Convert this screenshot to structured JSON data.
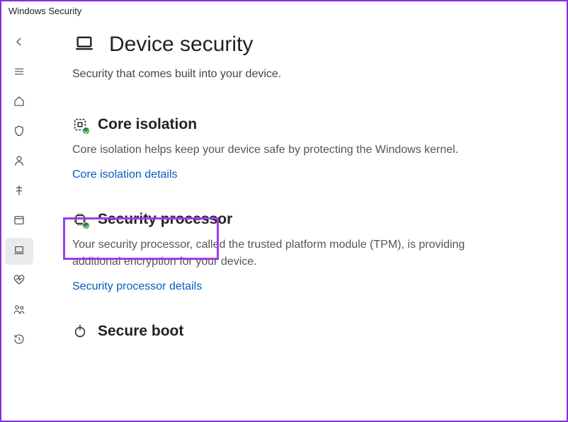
{
  "window": {
    "title": "Windows Security"
  },
  "sidebar": {
    "items": [
      {
        "name": "back",
        "icon": "arrow-left"
      },
      {
        "name": "menu",
        "icon": "menu"
      },
      {
        "name": "home",
        "icon": "home"
      },
      {
        "name": "virus-protection",
        "icon": "shield"
      },
      {
        "name": "account-protection",
        "icon": "person"
      },
      {
        "name": "firewall-network",
        "icon": "wifi"
      },
      {
        "name": "app-browser-control",
        "icon": "window"
      },
      {
        "name": "device-security",
        "icon": "laptop",
        "selected": true
      },
      {
        "name": "device-performance",
        "icon": "heart"
      },
      {
        "name": "family-options",
        "icon": "people"
      },
      {
        "name": "protection-history",
        "icon": "history"
      }
    ]
  },
  "page": {
    "title": "Device security",
    "subtitle": "Security that comes built into your device."
  },
  "sections": {
    "core_isolation": {
      "title": "Core isolation",
      "desc": "Core isolation helps keep your device safe by protecting the Windows kernel.",
      "link": "Core isolation details"
    },
    "security_processor": {
      "title": "Security processor",
      "desc": "Your security processor, called the trusted platform module (TPM), is providing additional encryption for your device.",
      "link": "Security processor details"
    },
    "secure_boot": {
      "title": "Secure boot"
    }
  }
}
